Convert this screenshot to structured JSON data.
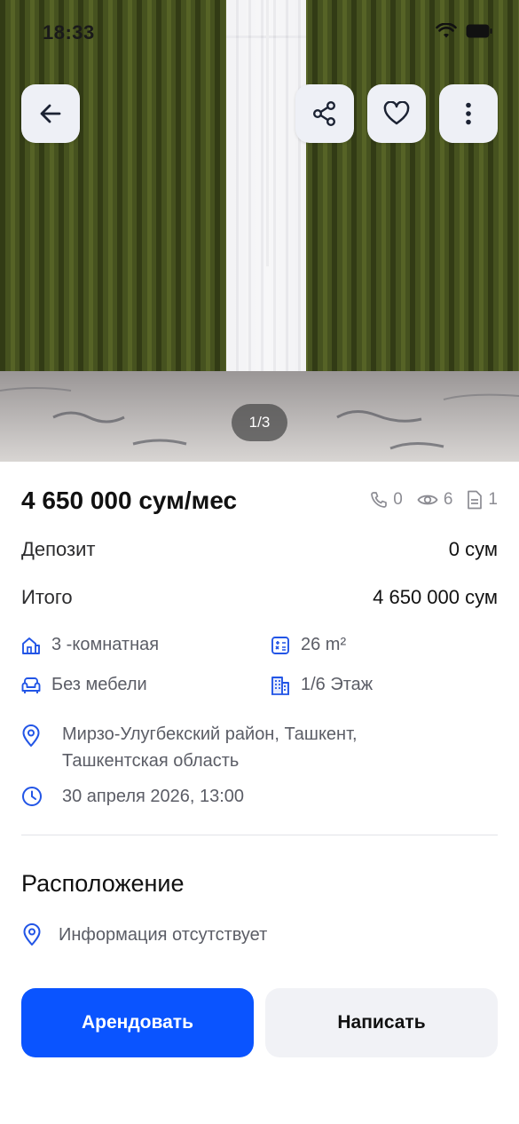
{
  "status": {
    "time": "18:33"
  },
  "gallery": {
    "pager": "1/3"
  },
  "listing": {
    "price": "4 650 000 сум/мес",
    "stats": {
      "calls": "0",
      "views": "6",
      "docs": "1"
    },
    "deposit_label": "Депозит",
    "deposit_value": "0 сум",
    "total_label": "Итого",
    "total_value": "4 650 000 сум",
    "rooms": "3 -комнатная",
    "area": "26 m²",
    "furniture": "Без мебели",
    "floor": "1/6 Этаж",
    "address_line1": "Мирзо-Улугбекский район, Ташкент,",
    "address_line2": "Ташкентская область",
    "date": "30 апреля 2026, 13:00"
  },
  "location": {
    "title": "Расположение",
    "info": "Информация отсутствует"
  },
  "actions": {
    "rent_label": "Арендовать",
    "write_label": "Написать"
  },
  "colors": {
    "accent": "#0a54ff",
    "icon": "#2255e6",
    "muted": "#5b5d66"
  }
}
